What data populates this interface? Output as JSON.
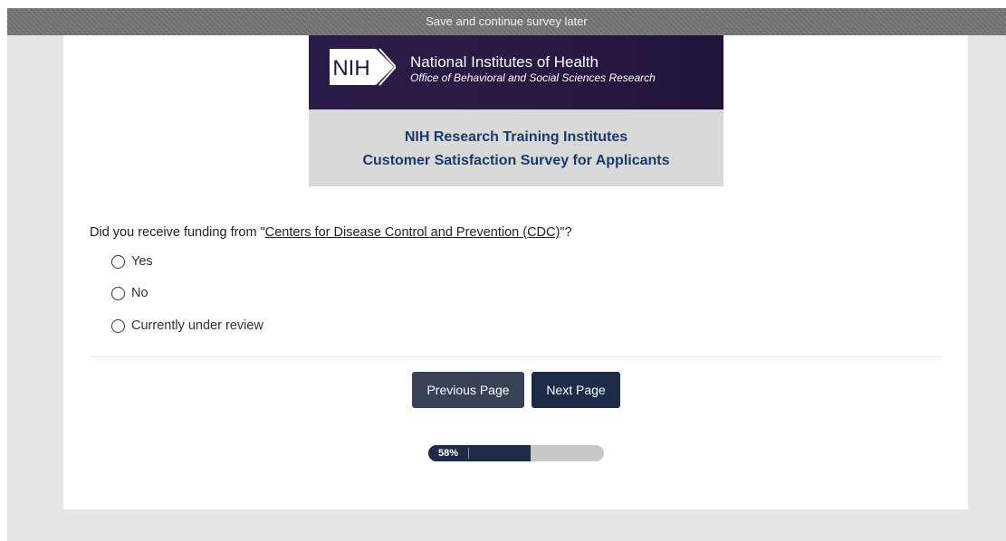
{
  "save_bar": {
    "label": "Save and continue survey later"
  },
  "banner": {
    "logo_text": "NIH",
    "org_name": "National Institutes of Health",
    "org_sub": "Office of Behavioral and Social Sciences Research",
    "title_line1": "NIH Research Training Institutes",
    "title_line2": "Customer Satisfaction Survey for Applicants"
  },
  "question": {
    "prefix": "Did you receive funding from \"",
    "link_text": "Centers for Disease Control and Prevention (CDC)",
    "suffix": "\"?",
    "options": [
      {
        "label": "Yes"
      },
      {
        "label": "No"
      },
      {
        "label": "Currently under review"
      }
    ]
  },
  "nav": {
    "prev_label": "Previous Page",
    "next_label": "Next Page"
  },
  "progress": {
    "label": "58%",
    "value": 0.58
  },
  "colors": {
    "accent_dark": "#1d2a48",
    "title_blue": "#1b3a6b",
    "banner_purple": "#2a1c48"
  }
}
